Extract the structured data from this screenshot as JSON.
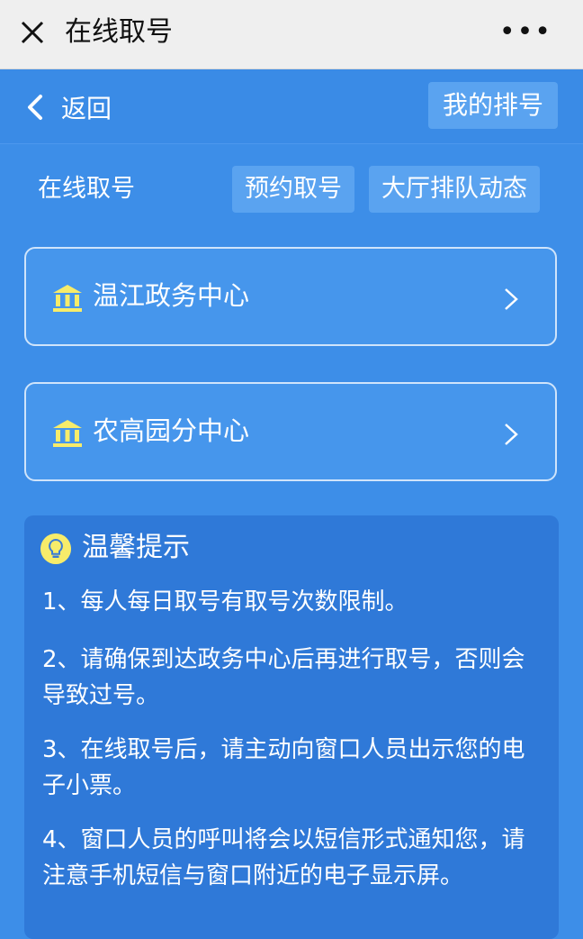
{
  "window": {
    "title": "在线取号",
    "more_label": "•••"
  },
  "nav": {
    "back_label": "返回",
    "my_queue_label": "我的排号"
  },
  "tabs": {
    "current": "在线取号",
    "items": [
      "预约取号",
      "大厅排队动态"
    ]
  },
  "centers": [
    {
      "name": "温江政务中心"
    },
    {
      "name": "农高园分中心"
    }
  ],
  "tips": {
    "title": "温馨提示",
    "items": [
      "1、每人每日取号有取号次数限制。",
      "2、请确保到达政务中心后再进行取号，否则会导致过号。",
      "3、在线取号后，请主动向窗口人员出示您的电子小票。",
      "4、窗口人员的呼叫将会以短信形式通知您，请注意手机短信与窗口附近的电子显示屏。"
    ]
  },
  "colors": {
    "background": "#3d8ee8",
    "button": "#5aa3f0",
    "tips_panel": "#2f79d8",
    "icon_yellow": "#f7ec6a"
  }
}
